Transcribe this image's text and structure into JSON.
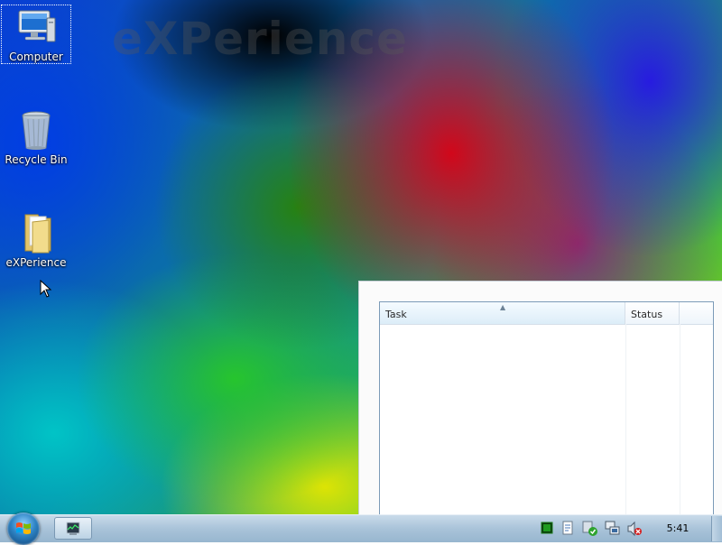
{
  "wallpaper": {
    "text": "eXPerience"
  },
  "desktop_icons": [
    {
      "label": "Computer",
      "icon": "computer-icon",
      "selected": true
    },
    {
      "label": "Recycle Bin",
      "icon": "recycle-bin-icon",
      "selected": false
    },
    {
      "label": "eXPerience",
      "icon": "folder-icon",
      "selected": false
    }
  ],
  "window": {
    "columns": [
      {
        "label": "Task",
        "sorted": "ascending"
      },
      {
        "label": "Status"
      },
      {
        "label": ""
      }
    ],
    "rows": []
  },
  "taskbar": {
    "start_icon": "windows-start-orb",
    "open_apps": [
      {
        "icon": "task-manager-icon"
      }
    ],
    "tray_icons": [
      "cpu-meter-icon",
      "document-icon",
      "security-check-icon",
      "network-icon",
      "volume-muted-icon"
    ],
    "clock": "5:41"
  },
  "colors": {
    "taskbar": "#a9c3d9",
    "header_selected": "#dcedf8"
  }
}
